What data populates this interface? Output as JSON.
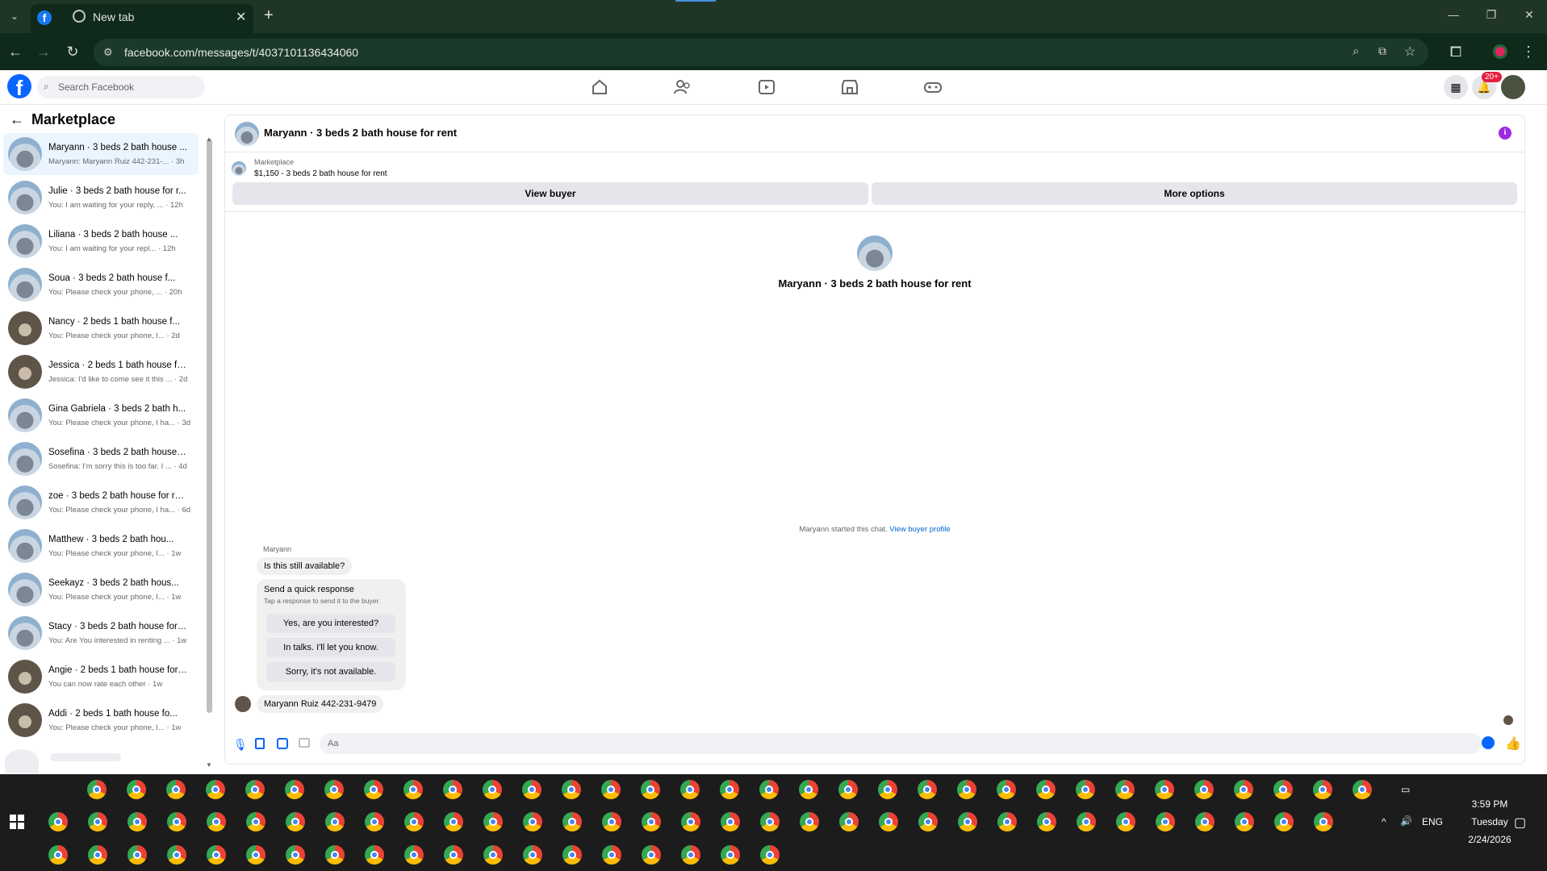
{
  "browser": {
    "tab_active_title": "",
    "tab_title": "New tab",
    "url": "facebook.com/messages/t/4037101136434060"
  },
  "fb": {
    "search_placeholder": "Search Facebook",
    "notif_badge": "20+"
  },
  "sidebar": {
    "title": "Marketplace",
    "conversations": [
      {
        "name": "Maryann · 3 beds 2 bath house ...",
        "preview": "Maryann: Maryann Ruiz 442-231-... · 3h",
        "avatar": "house"
      },
      {
        "name": "Julie · 3 beds 2 bath house for r...",
        "preview": "You: I am waiting for your reply, ... · 12h",
        "avatar": "house"
      },
      {
        "name": "Liliana · 3 beds 2 bath house ...",
        "preview": "You: I am waiting for your repl... · 12h",
        "avatar": "house"
      },
      {
        "name": "Soua · 3 beds 2 bath house f...",
        "preview": "You: Please check your phone, ... · 20h",
        "avatar": "house"
      },
      {
        "name": "Nancy · 2 beds 1 bath house f...",
        "preview": "You: Please check your phone, I... · 2d",
        "avatar": "dark"
      },
      {
        "name": "Jessica · 2 beds 1 bath house fo...",
        "preview": "Jessica: I'd like to come see it this ... · 2d",
        "avatar": "dark"
      },
      {
        "name": "Gina Gabriela · 3 beds 2 bath h...",
        "preview": "You: Please check your phone, I ha... · 3d",
        "avatar": "house"
      },
      {
        "name": "Sosefina · 3 beds 2 bath house f...",
        "preview": "Sosefina: I'm sorry this is too far. I ... · 4d",
        "avatar": "house"
      },
      {
        "name": "zoe · 3 beds 2 bath house for re...",
        "preview": "You: Please check your phone, I ha... · 6d",
        "avatar": "house"
      },
      {
        "name": "Matthew · 3 beds 2 bath hou...",
        "preview": "You: Please check your phone, I... · 1w",
        "avatar": "house"
      },
      {
        "name": "Seekayz · 3 beds 2 bath hous...",
        "preview": "You: Please check your phone, I... · 1w",
        "avatar": "house"
      },
      {
        "name": "Stacy · 3 beds 2 bath house for ...",
        "preview": "You: Are You interested in renting ... · 1w",
        "avatar": "house"
      },
      {
        "name": "Angie · 2 beds 1 bath house for ...",
        "preview": "You can now rate each other · 1w",
        "avatar": "dark"
      },
      {
        "name": "Addi · 2 beds 1 bath house fo...",
        "preview": "You: Please check your phone, I... · 1w",
        "avatar": "dark"
      }
    ]
  },
  "chat": {
    "title": "Maryann · 3 beds 2 bath house for rent",
    "listing_source": "Marketplace",
    "listing_line": "$1,150 - 3 beds 2 bath house for rent",
    "view_buyer": "View buyer",
    "more_options": "More options",
    "center_title": "Maryann · 3 beds 2 bath house for rent",
    "started_text": "Maryann started this chat.",
    "view_profile": "View buyer profile",
    "sender": "Maryann",
    "msg1": "Is this still available?",
    "quick_title": "Send a quick response",
    "quick_sub": "Tap a response to send it to the buyer.",
    "quick": [
      "Yes, are you interested?",
      "In talks. I'll let you know.",
      "Sorry, it's not available."
    ],
    "msg2": "Maryann Ruiz 442-231-9479",
    "composer_placeholder": "Aa"
  },
  "tray": {
    "lang": "ENG",
    "time": "3:59 PM",
    "day": "Tuesday",
    "date": "2/24/2026"
  },
  "colors": {
    "fb_blue": "#0866ff",
    "link": "#0064d1",
    "tab_bg": "#1f3526"
  }
}
